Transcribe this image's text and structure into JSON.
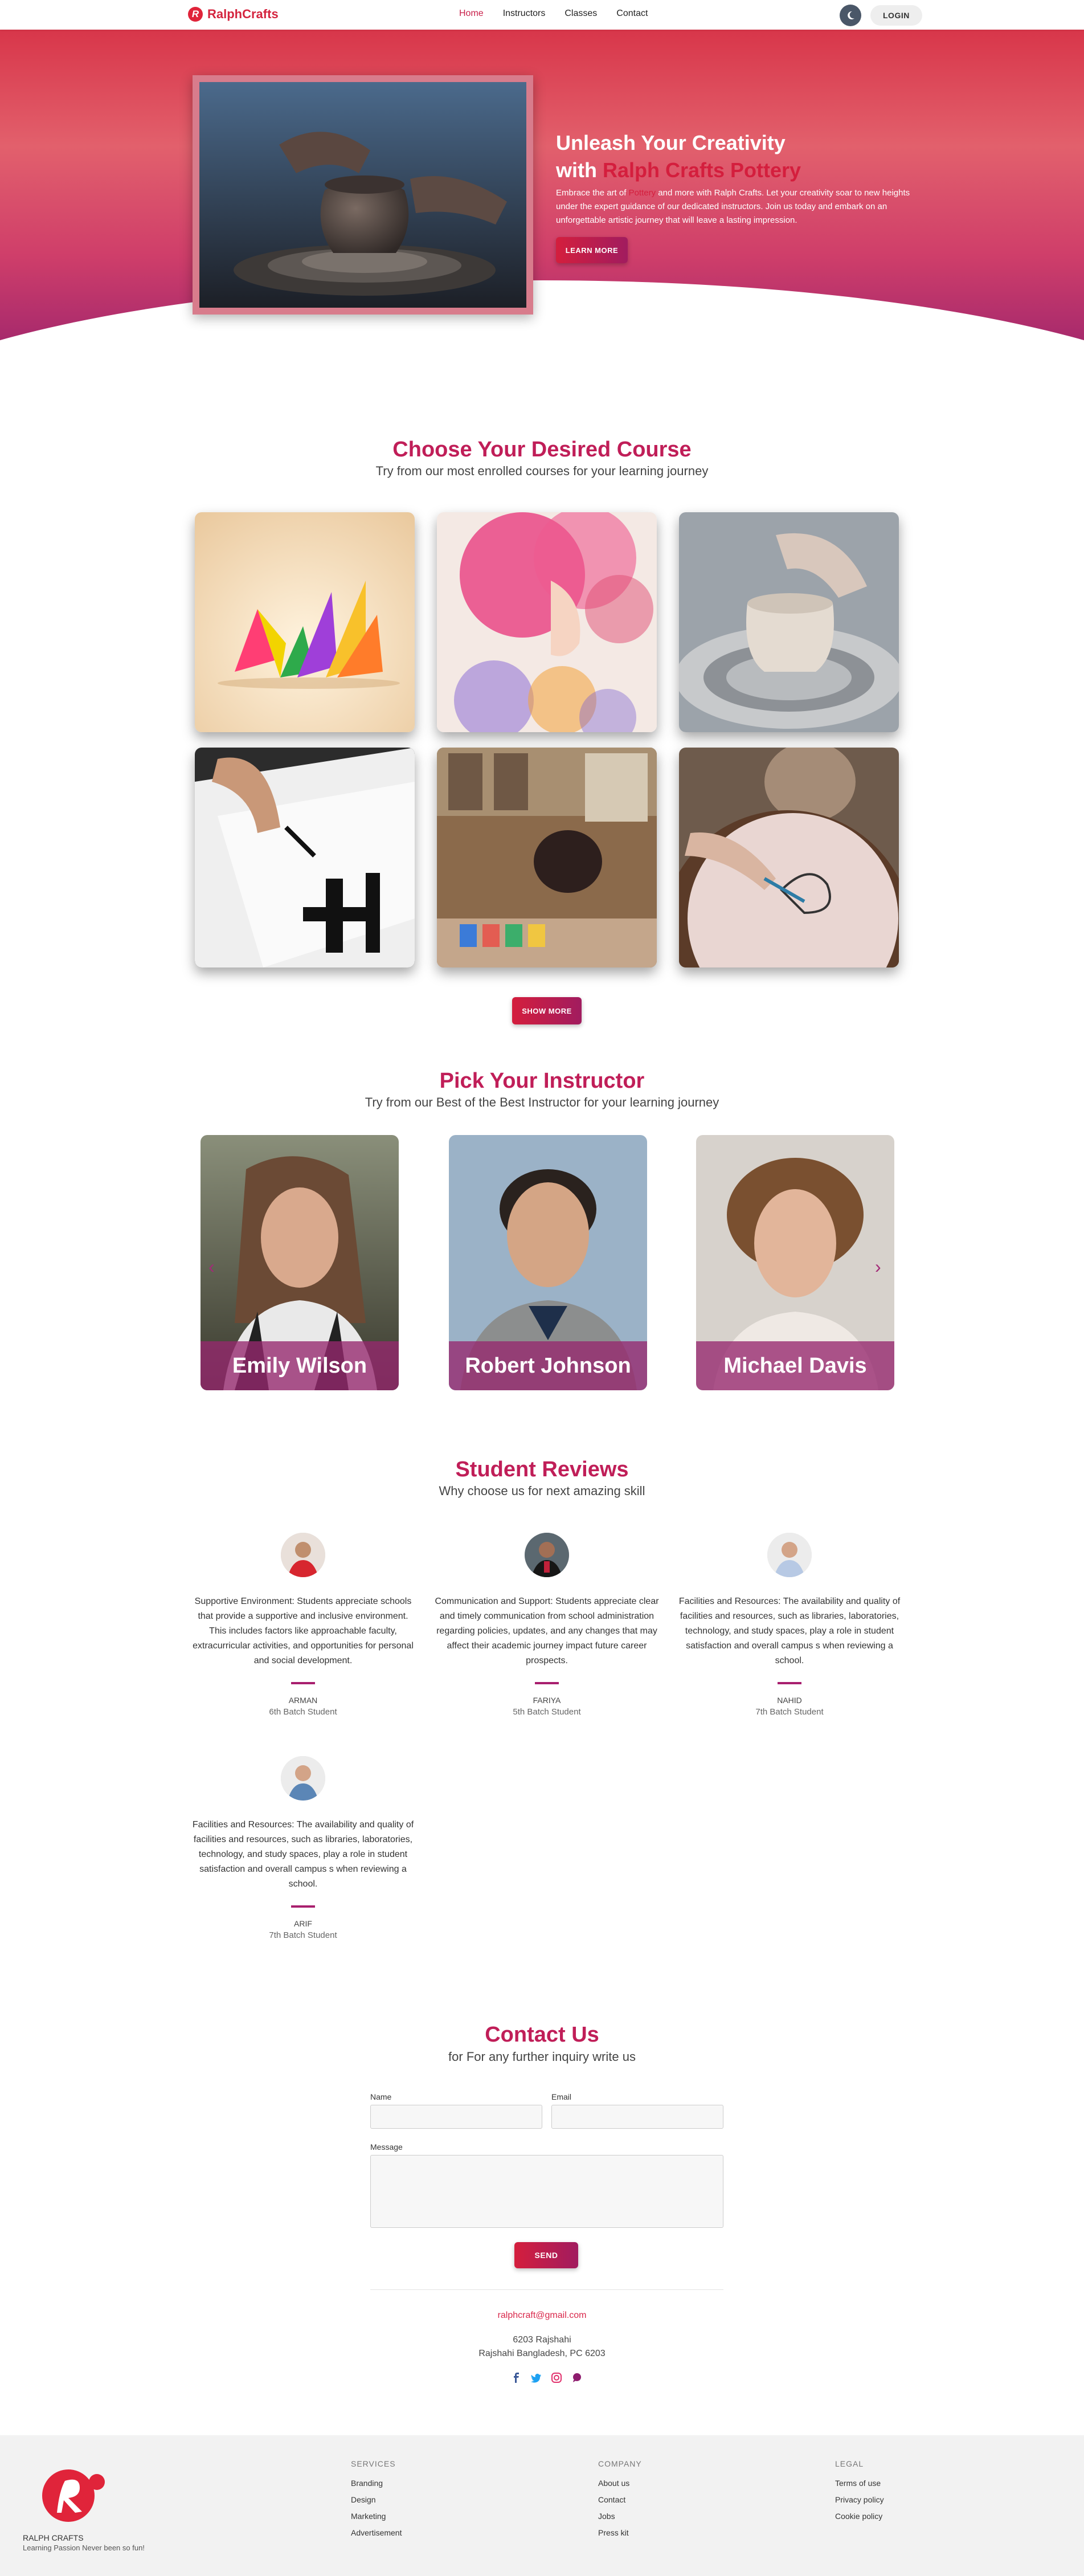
{
  "nav": {
    "brand": "RalphCrafts",
    "brand_initial": "R",
    "links": [
      "Home",
      "Instructors",
      "Classes",
      "Contact"
    ],
    "login": "LOGIN",
    "theme_icon": "moon-icon"
  },
  "hero": {
    "title_line1": "Unleash Your Creativity",
    "title_with": "with ",
    "title_highlight": "Ralph Crafts Pottery",
    "desc_pre": "Embrace the art of ",
    "desc_highlight": "Pottery",
    "desc_post": " and more with Ralph Crafts. Let your creativity soar to new heights under the expert guidance of our dedicated instructors. Join us today and embark on an unforgettable artistic journey that will leave a lasting impression.",
    "button": "LEARN MORE",
    "slides_total": 5,
    "slide_active": 1
  },
  "courses": {
    "title": "Choose Your Desired Course",
    "subtitle": "Try from our most enrolled courses for your learning journey",
    "button": "SHOW MORE"
  },
  "instructors": {
    "title": "Pick Your Instructor",
    "subtitle": "Try from our Best of the Best Instructor for your learning journey",
    "items": [
      {
        "name": "Emily Wilson"
      },
      {
        "name": "Robert Johnson"
      },
      {
        "name": "Michael Davis"
      }
    ],
    "prev_icon": "chevron-left-icon",
    "next_icon": "chevron-right-icon"
  },
  "reviews": {
    "title": "Student Reviews",
    "subtitle": "Why choose us for next amazing skill",
    "items": [
      {
        "text": "Supportive Environment: Students appreciate schools that provide a supportive and inclusive environment. This includes factors like approachable faculty, extracurricular activities, and opportunities for personal and social development.",
        "name": "ARMAN",
        "batch": "6th Batch Student"
      },
      {
        "text": "Communication and Support: Students appreciate clear and timely communication from school administration regarding policies, updates, and any changes that may affect their academic journey impact future career prospects.",
        "name": "FARIYA",
        "batch": "5th Batch Student"
      },
      {
        "text": "Facilities and Resources: The availability and quality of facilities and resources, such as libraries, laboratories, technology, and study spaces, play a role in student satisfaction and overall campus s when reviewing a school.",
        "name": "NAHID",
        "batch": "7th Batch Student"
      },
      {
        "text": "Facilities and Resources: The availability and quality of facilities and resources, such as libraries, laboratories, technology, and study spaces, play a role in student satisfaction and overall campus s when reviewing a school.",
        "name": "ARIF",
        "batch": "7th Batch Student"
      }
    ]
  },
  "contact": {
    "title": "Contact Us",
    "subtitle": "for For any further inquiry write us",
    "name_label": "Name",
    "email_label": "Email",
    "message_label": "Message",
    "send": "SEND",
    "email": "ralphcraft@gmail.com",
    "address1": "6203 Rajshahi",
    "address2": "Rajshahi Bangladesh, PC 6203",
    "social_icons": [
      "facebook-icon",
      "twitter-icon",
      "instagram-icon",
      "chat-icon"
    ]
  },
  "footer": {
    "brand": "RALPH CRAFTS",
    "tagline": "Learning Passion Never been so fun!",
    "services": {
      "heading": "SERVICES",
      "items": [
        "Branding",
        "Design",
        "Marketing",
        "Advertisement"
      ]
    },
    "company": {
      "heading": "COMPANY",
      "items": [
        "About us",
        "Contact",
        "Jobs",
        "Press kit"
      ]
    },
    "legal": {
      "heading": "LEGAL",
      "items": [
        "Terms of use",
        "Privacy policy",
        "Cookie policy"
      ]
    }
  }
}
